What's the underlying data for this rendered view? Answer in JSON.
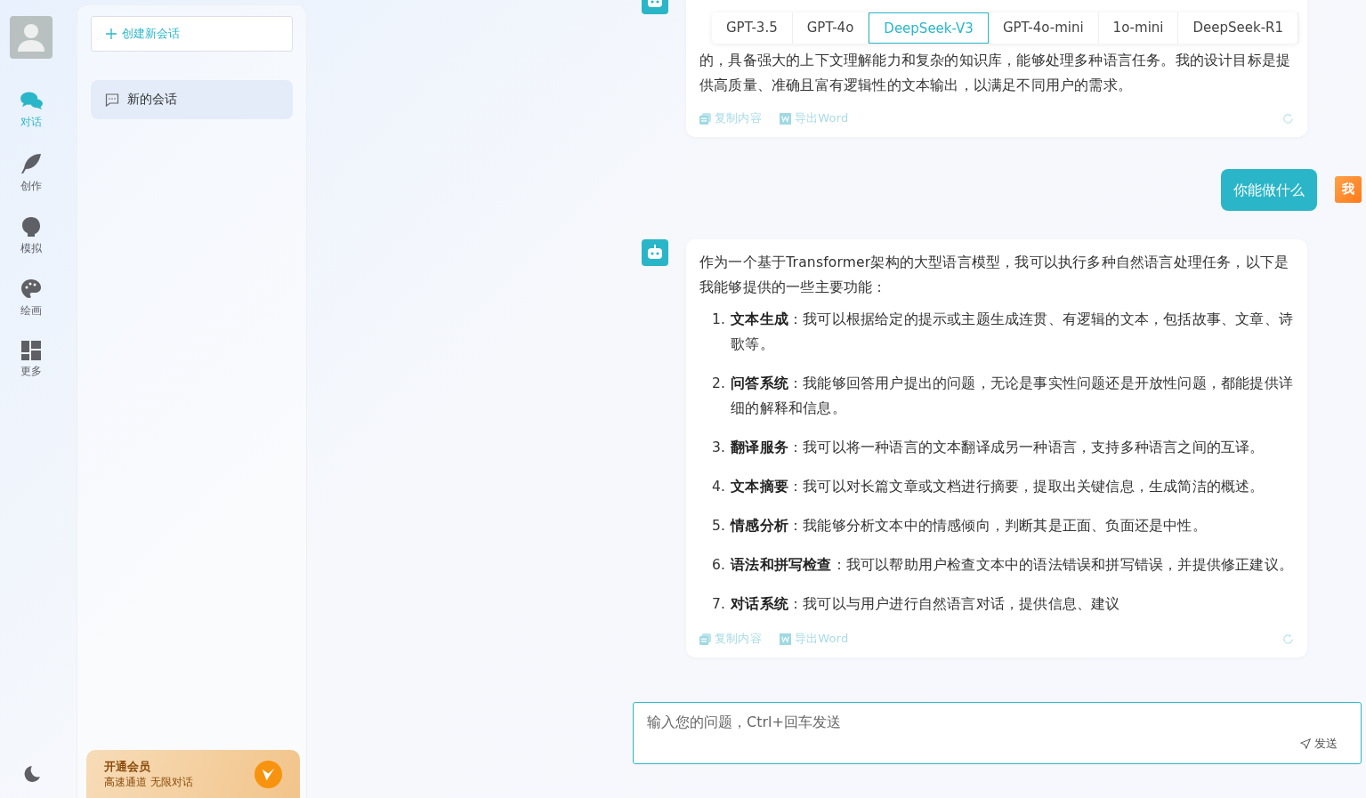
{
  "rail": {
    "items": [
      {
        "label": "对话",
        "selected": true
      },
      {
        "label": "创作",
        "selected": false
      },
      {
        "label": "模拟",
        "selected": false
      },
      {
        "label": "绘画",
        "selected": false
      },
      {
        "label": "更多",
        "selected": false
      }
    ]
  },
  "sidebar": {
    "new_chat_button": "创建新会话",
    "conversations": [
      {
        "title": "新的会话",
        "selected": true
      }
    ],
    "vip": {
      "title": "开通会员",
      "subtitle": "高速通道 无限对话"
    }
  },
  "model_tabs": [
    {
      "label": "GPT-3.5",
      "selected": false
    },
    {
      "label": "GPT-4o",
      "selected": false
    },
    {
      "label": "DeepSeek-V3",
      "selected": true
    },
    {
      "label": "GPT-4o-mini",
      "selected": false
    },
    {
      "label": "1o-mini",
      "selected": false
    },
    {
      "label": "DeepSeek-R1",
      "selected": false
    }
  ],
  "messages": [
    {
      "kind": "bot",
      "text": "的，具备强大的上下文理解能力和复杂的知识库，能够处理多种语言任务。我的设计目标是提供高质量、准确且富有逻辑性的文本输出，以满足不同用户的需求。",
      "actions": [
        "复制内容",
        "导出Word"
      ]
    },
    {
      "kind": "user",
      "text": "你能做什么",
      "avatar_label": "我"
    },
    {
      "kind": "bot",
      "text": "作为一个基于Transformer架构的大型语言模型，我可以执行多种自然语言处理任务，以下是我能够提供的一些主要功能：",
      "list": [
        {
          "number": "1.",
          "text": "**文本生成**：我可以根据给定的提示或主题生成连贯、有逻辑的文本，包括故事、文章、诗歌等。"
        },
        {
          "number": "2.",
          "text": "**问答系统**：我能够回答用户提出的问题，无论是事实性问题还是开放性问题，都能提供详细的解释和信息。"
        },
        {
          "number": "3.",
          "text": "**翻译服务**：我可以将一种语言的文本翻译成另一种语言，支持多种语言之间的互译。"
        },
        {
          "number": "4.",
          "text": "**文本摘要**：我可以对长篇文章或文档进行摘要，提取出关键信息，生成简洁的概述。"
        },
        {
          "number": "5.",
          "text": "**情感分析**：我能够分析文本中的情感倾向，判断其是正面、负面还是中性。"
        },
        {
          "number": "6.",
          "text": "**语法和拼写检查**：我可以帮助用户检查文本中的语法错误和拼写错误，并提供修正建议。"
        },
        {
          "number": "7.",
          "text": "**对话系统**：我可以与用户进行自然语言对话，提供信息、建议"
        }
      ],
      "actions": [
        "复制内容",
        "导出Word"
      ]
    }
  ],
  "input": {
    "placeholder": "输入您的问题，Ctrl+回车发送",
    "send_label": "发送"
  }
}
